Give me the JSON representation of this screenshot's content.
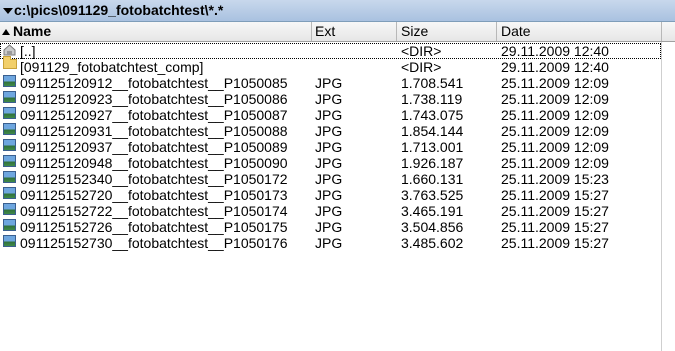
{
  "path": {
    "text": "c:\\pics\\091129_fotobatchtest\\*.*"
  },
  "columns": {
    "name": "Name",
    "ext": "Ext",
    "size": "Size",
    "date": "Date"
  },
  "rows": [
    {
      "icon": "up-dir-icon",
      "name": "[..]",
      "ext": "",
      "size": "<DIR>",
      "date": "29.11.2009 12:40"
    },
    {
      "icon": "folder-icon",
      "name": "[091129_fotobatchtest_comp]",
      "ext": "",
      "size": "<DIR>",
      "date": "29.11.2009 12:40"
    },
    {
      "icon": "image-file-icon",
      "name": "091125120912__fotobatchtest__P1050085",
      "ext": "JPG",
      "size": "1.708.541",
      "date": "25.11.2009 12:09"
    },
    {
      "icon": "image-file-icon",
      "name": "091125120923__fotobatchtest__P1050086",
      "ext": "JPG",
      "size": "1.738.119",
      "date": "25.11.2009 12:09"
    },
    {
      "icon": "image-file-icon",
      "name": "091125120927__fotobatchtest__P1050087",
      "ext": "JPG",
      "size": "1.743.075",
      "date": "25.11.2009 12:09"
    },
    {
      "icon": "image-file-icon",
      "name": "091125120931__fotobatchtest__P1050088",
      "ext": "JPG",
      "size": "1.854.144",
      "date": "25.11.2009 12:09"
    },
    {
      "icon": "image-file-icon",
      "name": "091125120937__fotobatchtest__P1050089",
      "ext": "JPG",
      "size": "1.713.001",
      "date": "25.11.2009 12:09"
    },
    {
      "icon": "image-file-icon",
      "name": "091125120948__fotobatchtest__P1050090",
      "ext": "JPG",
      "size": "1.926.187",
      "date": "25.11.2009 12:09"
    },
    {
      "icon": "image-file-icon",
      "name": "091125152340__fotobatchtest__P1050172",
      "ext": "JPG",
      "size": "1.660.131",
      "date": "25.11.2009 15:23"
    },
    {
      "icon": "image-file-icon",
      "name": "091125152720__fotobatchtest__P1050173",
      "ext": "JPG",
      "size": "3.763.525",
      "date": "25.11.2009 15:27"
    },
    {
      "icon": "image-file-icon",
      "name": "091125152722__fotobatchtest__P1050174",
      "ext": "JPG",
      "size": "3.465.191",
      "date": "25.11.2009 15:27"
    },
    {
      "icon": "image-file-icon",
      "name": "091125152726__fotobatchtest__P1050175",
      "ext": "JPG",
      "size": "3.504.856",
      "date": "25.11.2009 15:27"
    },
    {
      "icon": "image-file-icon",
      "name": "091125152730__fotobatchtest__P1050176",
      "ext": "JPG",
      "size": "3.485.602",
      "date": "25.11.2009 15:27"
    }
  ]
}
